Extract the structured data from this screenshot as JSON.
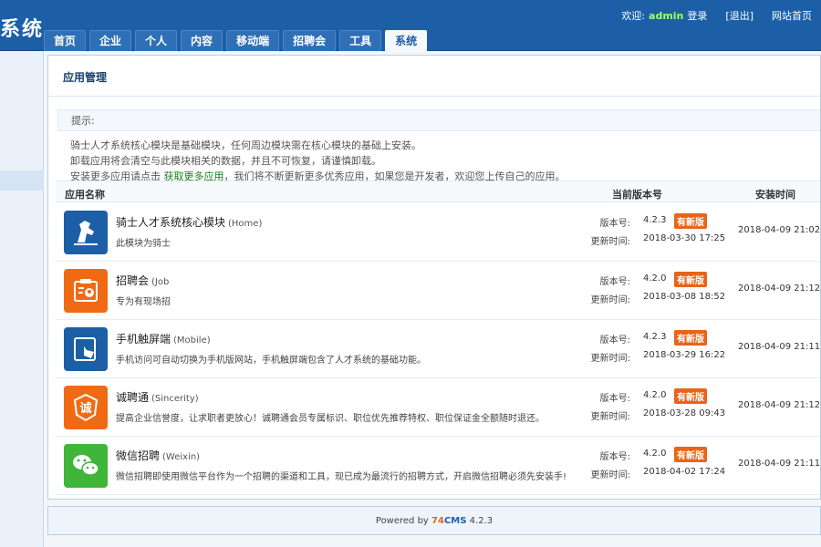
{
  "header": {
    "logo_text": "系统",
    "welcome": "欢迎:",
    "username": "admin",
    "login_label": "登录",
    "logout_label": "[退出]",
    "site_home": "网站首页"
  },
  "nav": {
    "tabs": [
      {
        "label": "首页"
      },
      {
        "label": "企业"
      },
      {
        "label": "个人"
      },
      {
        "label": "内容"
      },
      {
        "label": "移动端"
      },
      {
        "label": "招聘会"
      },
      {
        "label": "工具"
      },
      {
        "label": "系统",
        "active": true
      }
    ]
  },
  "page": {
    "title": "应用管理",
    "tips_label": "提示:",
    "tip1": "骑士人才系统核心模块是基础模块，任何周边模块需在核心模块的基础上安装。",
    "tip2": "卸载应用将会清空与此模块相关的数据，并且不可恢复，请谨慎卸载。",
    "tip3_pre": "安装更多应用请点击",
    "tip3_link": "获取更多应用",
    "tip3_post": "，我们将不断更新更多优秀应用，如果您是开发者，欢迎您上传自己的应用。"
  },
  "table": {
    "headers": {
      "name": "应用名称",
      "version": "当前版本号",
      "install_time": "安装时间"
    },
    "version_label": "版本号:",
    "updated_label": "更新时间:",
    "badge_label": "有新版",
    "rows": [
      {
        "name": "骑士人才系统核心模块",
        "code": "(Home)",
        "desc": "此模块为骑士",
        "version": "4.2.3",
        "updated": "2018-03-30 17:25",
        "installed": "2018-04-09 21:02",
        "icon": "knight-icon",
        "color": "#1c5fa6"
      },
      {
        "name": "招聘会",
        "code": "(Job",
        "desc": "专为有现场招",
        "version": "4.2.0",
        "updated": "2018-03-08 18:52",
        "installed": "2018-04-09 21:12",
        "icon": "jobfair-icon",
        "color": "#f06a14"
      },
      {
        "name": "手机触屏端",
        "code": "(Mobile)",
        "desc": "手机访问可自动切换为手机版网站，手机触屏端包含了人才系统的基础功能。",
        "version": "4.2.3",
        "updated": "2018-03-29 16:22",
        "installed": "2018-04-09 21:11",
        "icon": "touchscreen-icon",
        "color": "#1c5fa6"
      },
      {
        "name": "诚聘通",
        "code": "(Sincerity)",
        "desc": "提高企业信誉度，让求职者更放心！诚聘通会员专属标识、职位优先推荐特权、职位保证金全额随时退还。",
        "version": "4.2.0",
        "updated": "2018-03-28 09:43",
        "installed": "2018-04-09 21:12",
        "icon": "sincerity-icon",
        "color": "#f06a14"
      },
      {
        "name": "微信招聘",
        "code": "(Weixin)",
        "desc": "微信招聘即使用微信平台作为一个招聘的渠道和工具，现已成为最流行的招聘方式，开启微信招聘必须先安装手!",
        "version": "4.2.0",
        "updated": "2018-04-02 17:24",
        "installed": "2018-04-09 21:11",
        "icon": "wechat-icon",
        "color": "#3fb53a"
      }
    ]
  },
  "footer": {
    "powered": "Powered by",
    "brand_a": "74",
    "brand_b": "CMS",
    "version": "4.2.3"
  }
}
